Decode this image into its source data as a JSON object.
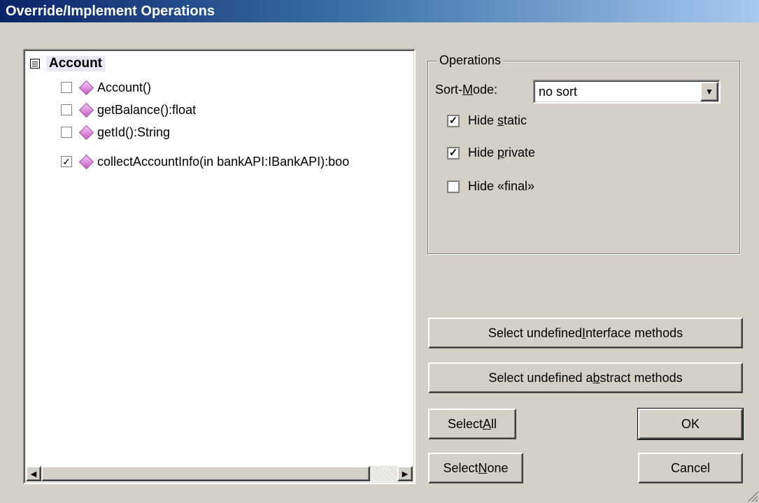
{
  "window": {
    "title": "Override/Implement Operations"
  },
  "tree": {
    "root_label": "Account",
    "items": [
      {
        "label": "Account()",
        "checked": false,
        "mark": ""
      },
      {
        "label": "getBalance():float",
        "checked": false,
        "mark": ""
      },
      {
        "label": "getId():String",
        "checked": false,
        "mark": ""
      },
      {
        "label": "collectAccountInfo(in bankAPI:IBankAPI):boo",
        "checked": true,
        "mark": "✓"
      }
    ],
    "scroll_left_icon": "◀",
    "scroll_right_icon": "▶"
  },
  "operations": {
    "legend": "Operations",
    "sort_mode": {
      "pre": "Sort-",
      "key": "M",
      "post": "ode:",
      "value": "no sort",
      "arrow": "▼"
    },
    "hide_static": {
      "pre": "Hide ",
      "key": "s",
      "post": "tatic",
      "checked": true,
      "mark": "✓"
    },
    "hide_private": {
      "pre": "Hide ",
      "key": "p",
      "post": "rivate",
      "checked": true,
      "mark": "✓"
    },
    "hide_final": {
      "label": "Hide «final»",
      "checked": false,
      "mark": ""
    }
  },
  "buttons": {
    "interface": {
      "pre": "Select undefined ",
      "key": "I",
      "post": "nterface methods"
    },
    "abstract": {
      "pre": "Select undefined a",
      "key": "b",
      "post": "stract methods"
    },
    "select_all": {
      "pre": "Select ",
      "key": "A",
      "post": "ll"
    },
    "select_none": {
      "pre": "Select ",
      "key": "N",
      "post": "one"
    },
    "ok": "OK",
    "cancel": "Cancel"
  },
  "colors": {
    "title_start": "#0a246a",
    "title_end": "#a6caf0",
    "face": "#d4d0c8",
    "diamond": "#c85ac8"
  }
}
